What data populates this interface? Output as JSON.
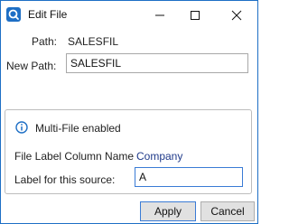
{
  "window": {
    "title": "Edit File"
  },
  "form": {
    "path_label": "Path:",
    "path_value": "SALESFIL",
    "new_path_label": "New Path:",
    "new_path_value": "SALESFIL"
  },
  "multifile": {
    "heading": "Multi-File enabled",
    "column_name_label": "File Label Column Name",
    "column_name_value": "Company",
    "source_label": "Label for this source:",
    "source_value": "A"
  },
  "buttons": {
    "apply": "Apply",
    "cancel": "Cancel"
  },
  "colors": {
    "accent": "#1e6fc5",
    "link": "#1f3a8a",
    "button_bg": "#e1e1e1"
  },
  "icons": [
    "app-icon",
    "minimize-icon",
    "maximize-icon",
    "close-icon",
    "info-icon"
  ]
}
